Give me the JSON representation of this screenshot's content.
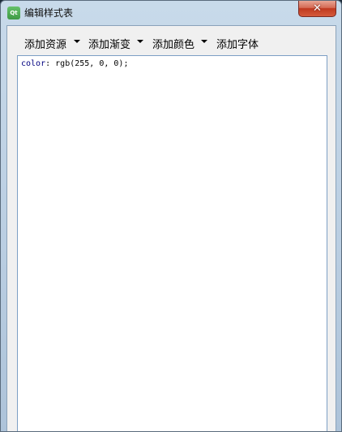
{
  "window": {
    "title": "编辑样式表",
    "app_icon_text": "Qt",
    "close_symbol": "✕"
  },
  "toolbar": {
    "add_resource": "添加资源",
    "add_gradient": "添加渐变",
    "add_color": "添加颜色",
    "add_font": "添加字体"
  },
  "editor": {
    "property": "color",
    "separator": ": ",
    "value": "rgb(255, 0, 0);"
  },
  "colors": {
    "property_keyword": "#000080",
    "editor_border": "#7c9fc4",
    "close_button": "#c0391f"
  }
}
